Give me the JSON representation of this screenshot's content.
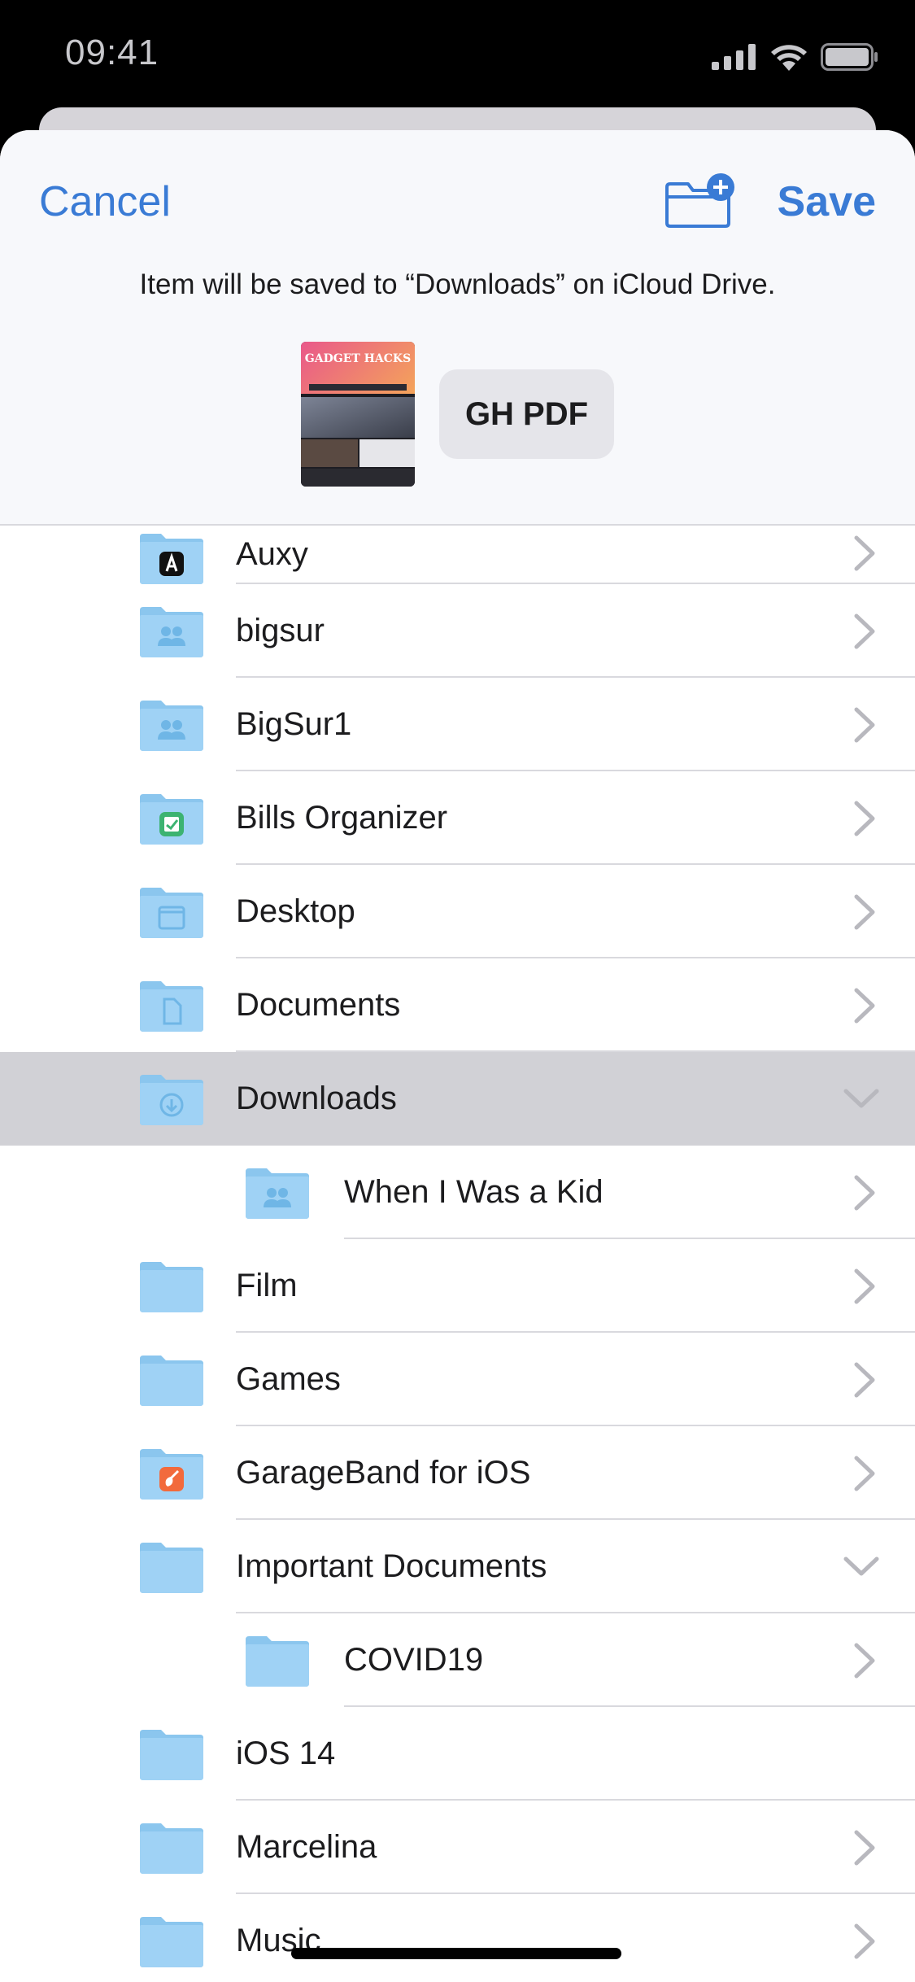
{
  "status_bar": {
    "time": "09:41"
  },
  "header": {
    "cancel_label": "Cancel",
    "save_label": "Save",
    "info_text": "Item will be saved to “Downloads” on iCloud Drive.",
    "file_name": "GH PDF",
    "thumbnail_title": "GADGET HACKS"
  },
  "colors": {
    "accent": "#3a7bd5",
    "folder": "#9fd2f5",
    "selected_row": "#d1d1d6"
  },
  "folders": [
    {
      "label": "Auxy",
      "icon": "auxy-app-folder-icon",
      "indent": 0,
      "chevron": "right"
    },
    {
      "label": "bigsur",
      "icon": "shared-folder-icon",
      "indent": 0,
      "chevron": "right"
    },
    {
      "label": "BigSur1",
      "icon": "shared-folder-icon",
      "indent": 0,
      "chevron": "right"
    },
    {
      "label": "Bills Organizer",
      "icon": "bills-organizer-app-folder-icon",
      "indent": 0,
      "chevron": "right"
    },
    {
      "label": "Desktop",
      "icon": "desktop-folder-icon",
      "indent": 0,
      "chevron": "right"
    },
    {
      "label": "Documents",
      "icon": "documents-folder-icon",
      "indent": 0,
      "chevron": "right"
    },
    {
      "label": "Downloads",
      "icon": "downloads-folder-icon",
      "indent": 0,
      "chevron": "down",
      "selected": true
    },
    {
      "label": "When I Was a Kid",
      "icon": "shared-folder-icon",
      "indent": 1,
      "chevron": "right"
    },
    {
      "label": "Film",
      "icon": "folder-icon",
      "indent": 0,
      "chevron": "right"
    },
    {
      "label": "Games",
      "icon": "folder-icon",
      "indent": 0,
      "chevron": "right"
    },
    {
      "label": "GarageBand for iOS",
      "icon": "garageband-app-folder-icon",
      "indent": 0,
      "chevron": "right"
    },
    {
      "label": "Important Documents",
      "icon": "folder-icon",
      "indent": 0,
      "chevron": "down"
    },
    {
      "label": "COVID19",
      "icon": "folder-icon",
      "indent": 1,
      "chevron": "right"
    },
    {
      "label": "iOS 14",
      "icon": "folder-icon",
      "indent": 0,
      "chevron": "none"
    },
    {
      "label": "Marcelina",
      "icon": "folder-icon",
      "indent": 0,
      "chevron": "right"
    },
    {
      "label": "Music",
      "icon": "folder-icon",
      "indent": 0,
      "chevron": "right"
    }
  ]
}
